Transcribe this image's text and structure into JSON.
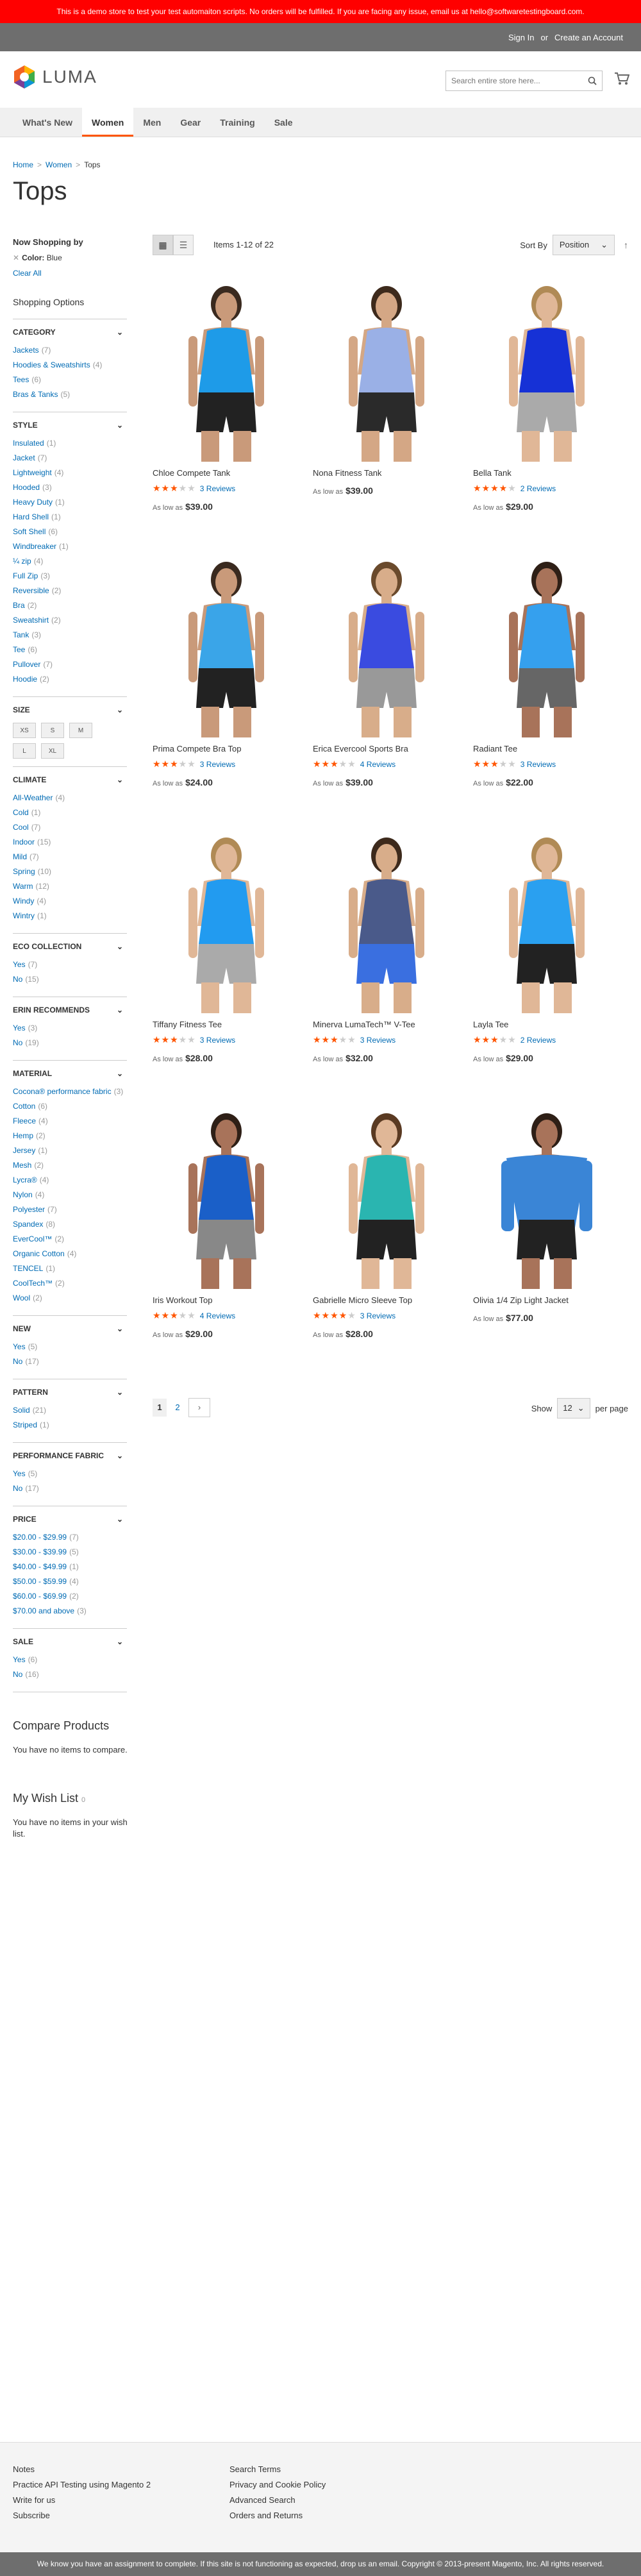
{
  "demo_notice": "This is a demo store to test your test automaiton scripts. No orders will be fulfilled. If you are facing any issue, email us at hello@softwaretestingboard.com.",
  "header": {
    "sign_in": "Sign In",
    "or": "or",
    "create_account": "Create an Account",
    "logo_text": "LUMA",
    "search_placeholder": "Search entire store here..."
  },
  "nav": [
    "What's New",
    "Women",
    "Men",
    "Gear",
    "Training",
    "Sale"
  ],
  "breadcrumb": {
    "home": "Home",
    "women": "Women",
    "current": "Tops",
    "sep": ">"
  },
  "page_title": "Tops",
  "sidebar": {
    "now_shopping": "Now Shopping by",
    "filter_label": "Color",
    "filter_value": "Blue",
    "clear_all": "Clear All",
    "shopping_options": "Shopping Options",
    "sections": [
      {
        "title": "Category",
        "options": [
          [
            "Jackets",
            "(7)"
          ],
          [
            "Hoodies & Sweatshirts",
            "(4)"
          ],
          [
            "Tees",
            "(6)"
          ],
          [
            "Bras & Tanks",
            "(5)"
          ]
        ]
      },
      {
        "title": "Style",
        "options": [
          [
            "Insulated",
            "(1)"
          ],
          [
            "Jacket",
            "(7)"
          ],
          [
            "Lightweight",
            "(4)"
          ],
          [
            "Hooded",
            "(3)"
          ],
          [
            "Heavy Duty",
            "(1)"
          ],
          [
            "Hard Shell",
            "(1)"
          ],
          [
            "Soft Shell",
            "(6)"
          ],
          [
            "Windbreaker",
            "(1)"
          ],
          [
            "¼ zip",
            "(4)"
          ],
          [
            "Full Zip",
            "(3)"
          ],
          [
            "Reversible",
            "(2)"
          ],
          [
            "Bra",
            "(2)"
          ],
          [
            "Sweatshirt",
            "(2)"
          ],
          [
            "Tank",
            "(3)"
          ],
          [
            "Tee",
            "(6)"
          ],
          [
            "Pullover",
            "(7)"
          ],
          [
            "Hoodie",
            "(2)"
          ]
        ]
      },
      {
        "title": "Size",
        "swatches": [
          "XS",
          "S",
          "M",
          "L",
          "XL"
        ]
      },
      {
        "title": "Climate",
        "options": [
          [
            "All-Weather",
            "(4)"
          ],
          [
            "Cold",
            "(1)"
          ],
          [
            "Cool",
            "(7)"
          ],
          [
            "Indoor",
            "(15)"
          ],
          [
            "Mild",
            "(7)"
          ],
          [
            "Spring",
            "(10)"
          ],
          [
            "Warm",
            "(12)"
          ],
          [
            "Windy",
            "(4)"
          ],
          [
            "Wintry",
            "(1)"
          ]
        ]
      },
      {
        "title": "Eco Collection",
        "options": [
          [
            "Yes",
            "(7)"
          ],
          [
            "No",
            "(15)"
          ]
        ]
      },
      {
        "title": "Erin Recommends",
        "options": [
          [
            "Yes",
            "(3)"
          ],
          [
            "No",
            "(19)"
          ]
        ]
      },
      {
        "title": "Material",
        "options": [
          [
            "Cocona® performance fabric",
            "(3)"
          ],
          [
            "Cotton",
            "(6)"
          ],
          [
            "Fleece",
            "(4)"
          ],
          [
            "Hemp",
            "(2)"
          ],
          [
            "Jersey",
            "(1)"
          ],
          [
            "Mesh",
            "(2)"
          ],
          [
            "Lycra®",
            "(4)"
          ],
          [
            "Nylon",
            "(4)"
          ],
          [
            "Polyester",
            "(7)"
          ],
          [
            "Spandex",
            "(8)"
          ],
          [
            "EverCool™",
            "(2)"
          ],
          [
            "Organic Cotton",
            "(4)"
          ],
          [
            "TENCEL",
            "(1)"
          ],
          [
            "CoolTech™",
            "(2)"
          ],
          [
            "Wool",
            "(2)"
          ]
        ]
      },
      {
        "title": "New",
        "options": [
          [
            "Yes",
            "(5)"
          ],
          [
            "No",
            "(17)"
          ]
        ]
      },
      {
        "title": "Pattern",
        "options": [
          [
            "Solid",
            "(21)"
          ],
          [
            "Striped",
            "(1)"
          ]
        ]
      },
      {
        "title": "Performance Fabric",
        "options": [
          [
            "Yes",
            "(5)"
          ],
          [
            "No",
            "(17)"
          ]
        ]
      },
      {
        "title": "Price",
        "options": [
          [
            "$20.00 - $29.99",
            "(7)"
          ],
          [
            "$30.00 - $39.99",
            "(5)"
          ],
          [
            "$40.00 - $49.99",
            "(1)"
          ],
          [
            "$50.00 - $59.99",
            "(4)"
          ],
          [
            "$60.00 - $69.99",
            "(2)"
          ],
          [
            "$70.00 and above",
            "(3)"
          ]
        ]
      },
      {
        "title": "Sale",
        "options": [
          [
            "Yes",
            "(6)"
          ],
          [
            "No",
            "(16)"
          ]
        ]
      }
    ],
    "compare_title": "Compare Products",
    "compare_text": "You have no items to compare.",
    "wish_title": "My Wish List",
    "wish_count": "0",
    "wish_text": "You have no items in your wish list."
  },
  "toolbar": {
    "amount": "Items 1-12 of 22",
    "sort_label": "Sort By",
    "sort_value": "Position"
  },
  "products": [
    {
      "name": "Chloe Compete Tank",
      "stars": 3,
      "reviews": "3 Reviews",
      "as_low": "As low as",
      "price": "$39.00",
      "top": "#1e9be8",
      "bottom": "#222",
      "skin": "#c99a7a",
      "hair": "#3a2a1f"
    },
    {
      "name": "Nona Fitness Tank",
      "stars": 0,
      "reviews": "",
      "as_low": "As low as",
      "price": "$39.00",
      "top": "#9ab0e6",
      "bottom": "#2a2a2a",
      "skin": "#d4a785",
      "hair": "#3d2a1c"
    },
    {
      "name": "Bella Tank",
      "stars": 4,
      "reviews": "2 Reviews",
      "as_low": "As low as",
      "price": "$29.00",
      "top": "#1631d6",
      "bottom": "#aaa",
      "skin": "#e0b797",
      "hair": "#b08a55"
    },
    {
      "name": "Prima Compete Bra Top",
      "stars": 3,
      "reviews": "3 Reviews",
      "as_low": "As low as",
      "price": "$24.00",
      "top": "#3aa5e8",
      "bottom": "#222",
      "skin": "#c99a7a",
      "hair": "#3a2a1f"
    },
    {
      "name": "Erica Evercool Sports Bra",
      "stars": 3,
      "reviews": "4 Reviews",
      "as_low": "As low as",
      "price": "$39.00",
      "top": "#3a4be0",
      "bottom": "#999",
      "skin": "#d8ad8a",
      "hair": "#6a4a2c"
    },
    {
      "name": "Radiant Tee",
      "stars": 3,
      "reviews": "3 Reviews",
      "as_low": "As low as",
      "price": "$22.00",
      "top": "#35a0ee",
      "bottom": "#666",
      "skin": "#a8735a",
      "hair": "#2e1f16"
    },
    {
      "name": "Tiffany Fitness Tee",
      "stars": 3,
      "reviews": "3 Reviews",
      "as_low": "As low as",
      "price": "$28.00",
      "top": "#229bf0",
      "bottom": "#aaa",
      "skin": "#e0b797",
      "hair": "#b08a55"
    },
    {
      "name": "Minerva LumaTech™ V-Tee",
      "stars": 3,
      "reviews": "3 Reviews",
      "as_low": "As low as",
      "price": "$32.00",
      "top": "#4a5a8a",
      "bottom": "#3a6fe0",
      "skin": "#d8ad8a",
      "hair": "#3d2a1c"
    },
    {
      "name": "Layla Tee",
      "stars": 3,
      "reviews": "2 Reviews",
      "as_low": "As low as",
      "price": "$29.00",
      "top": "#2aa0f0",
      "bottom": "#222",
      "skin": "#e0b797",
      "hair": "#b08a55"
    },
    {
      "name": "Iris Workout Top",
      "stars": 3,
      "reviews": "4 Reviews",
      "as_low": "As low as",
      "price": "$29.00",
      "top": "#1a5fc8",
      "bottom": "#888",
      "skin": "#a8735a",
      "hair": "#2e1f16"
    },
    {
      "name": "Gabrielle Micro Sleeve Top",
      "stars": 4,
      "reviews": "3 Reviews",
      "as_low": "As low as",
      "price": "$28.00",
      "top": "#2ab5b0",
      "bottom": "#222",
      "skin": "#e0b797",
      "hair": "#5a3a22"
    },
    {
      "name": "Olivia 1/4 Zip Light Jacket",
      "stars": 0,
      "reviews": "",
      "as_low": "As low as",
      "price": "$77.00",
      "top": "#3a85d6",
      "bottom": "#222",
      "skin": "#a8735a",
      "hair": "#2e1f16"
    }
  ],
  "pager": {
    "pages": [
      "1",
      "2"
    ],
    "next": "›",
    "show": "Show",
    "limit": "12",
    "per_page": "per page"
  },
  "footer": {
    "col1": [
      "Notes",
      "Practice API Testing using Magento 2",
      "Write for us",
      "Subscribe"
    ],
    "col2": [
      "Search Terms",
      "Privacy and Cookie Policy",
      "Advanced Search",
      "Orders and Returns"
    ],
    "copyright": "We know you have an assignment to complete. If this site is not functioning as expected, drop us an email. Copyright © 2013-present Magento, Inc. All rights reserved."
  },
  "colors": {
    "accent": "#ff5501",
    "link": "#006bb4",
    "demo_bar": "#ff0000",
    "header_bar": "#6e6e6e"
  }
}
